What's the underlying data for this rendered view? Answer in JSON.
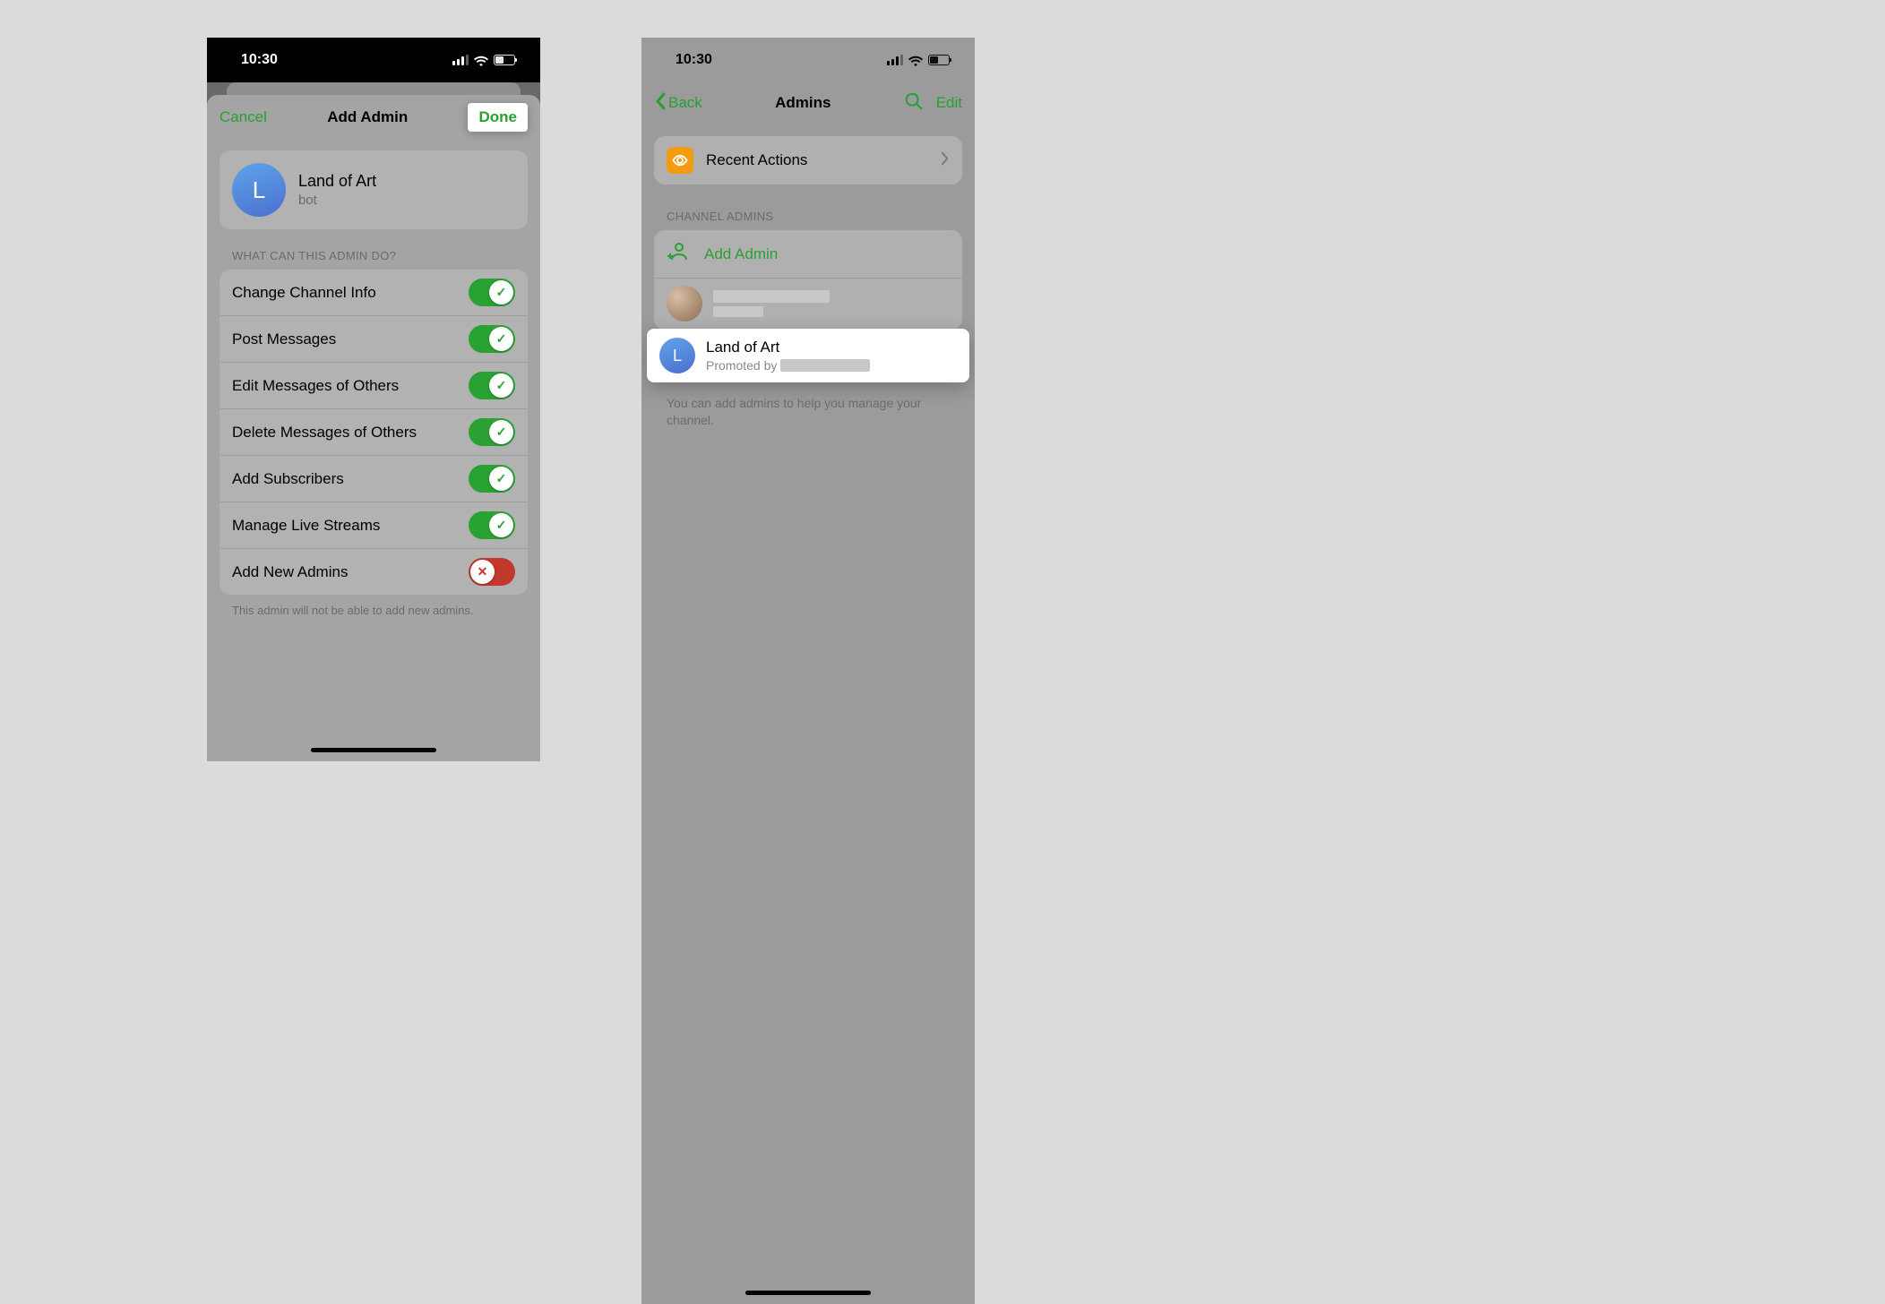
{
  "status": {
    "time": "10:30"
  },
  "left": {
    "nav": {
      "cancel": "Cancel",
      "title": "Add Admin",
      "done": "Done"
    },
    "subject": {
      "avatar_letter": "L",
      "name": "Land of Art",
      "subtitle": "bot"
    },
    "perm_header": "WHAT CAN THIS ADMIN DO?",
    "permissions": [
      {
        "label": "Change Channel Info",
        "on": true
      },
      {
        "label": "Post Messages",
        "on": true
      },
      {
        "label": "Edit Messages of Others",
        "on": true
      },
      {
        "label": "Delete Messages of Others",
        "on": true
      },
      {
        "label": "Add Subscribers",
        "on": true
      },
      {
        "label": "Manage Live Streams",
        "on": true
      },
      {
        "label": "Add New Admins",
        "on": false
      }
    ],
    "footer": "This admin will not be able to add new admins."
  },
  "right": {
    "nav": {
      "back": "Back",
      "title": "Admins",
      "edit": "Edit"
    },
    "recent_actions": "Recent Actions",
    "section": "CHANNEL ADMINS",
    "add_admin": "Add Admin",
    "highlighted": {
      "avatar_letter": "L",
      "name": "Land of Art",
      "promoted_prefix": "Promoted by"
    },
    "helper": "You can add admins to help you manage your channel."
  }
}
